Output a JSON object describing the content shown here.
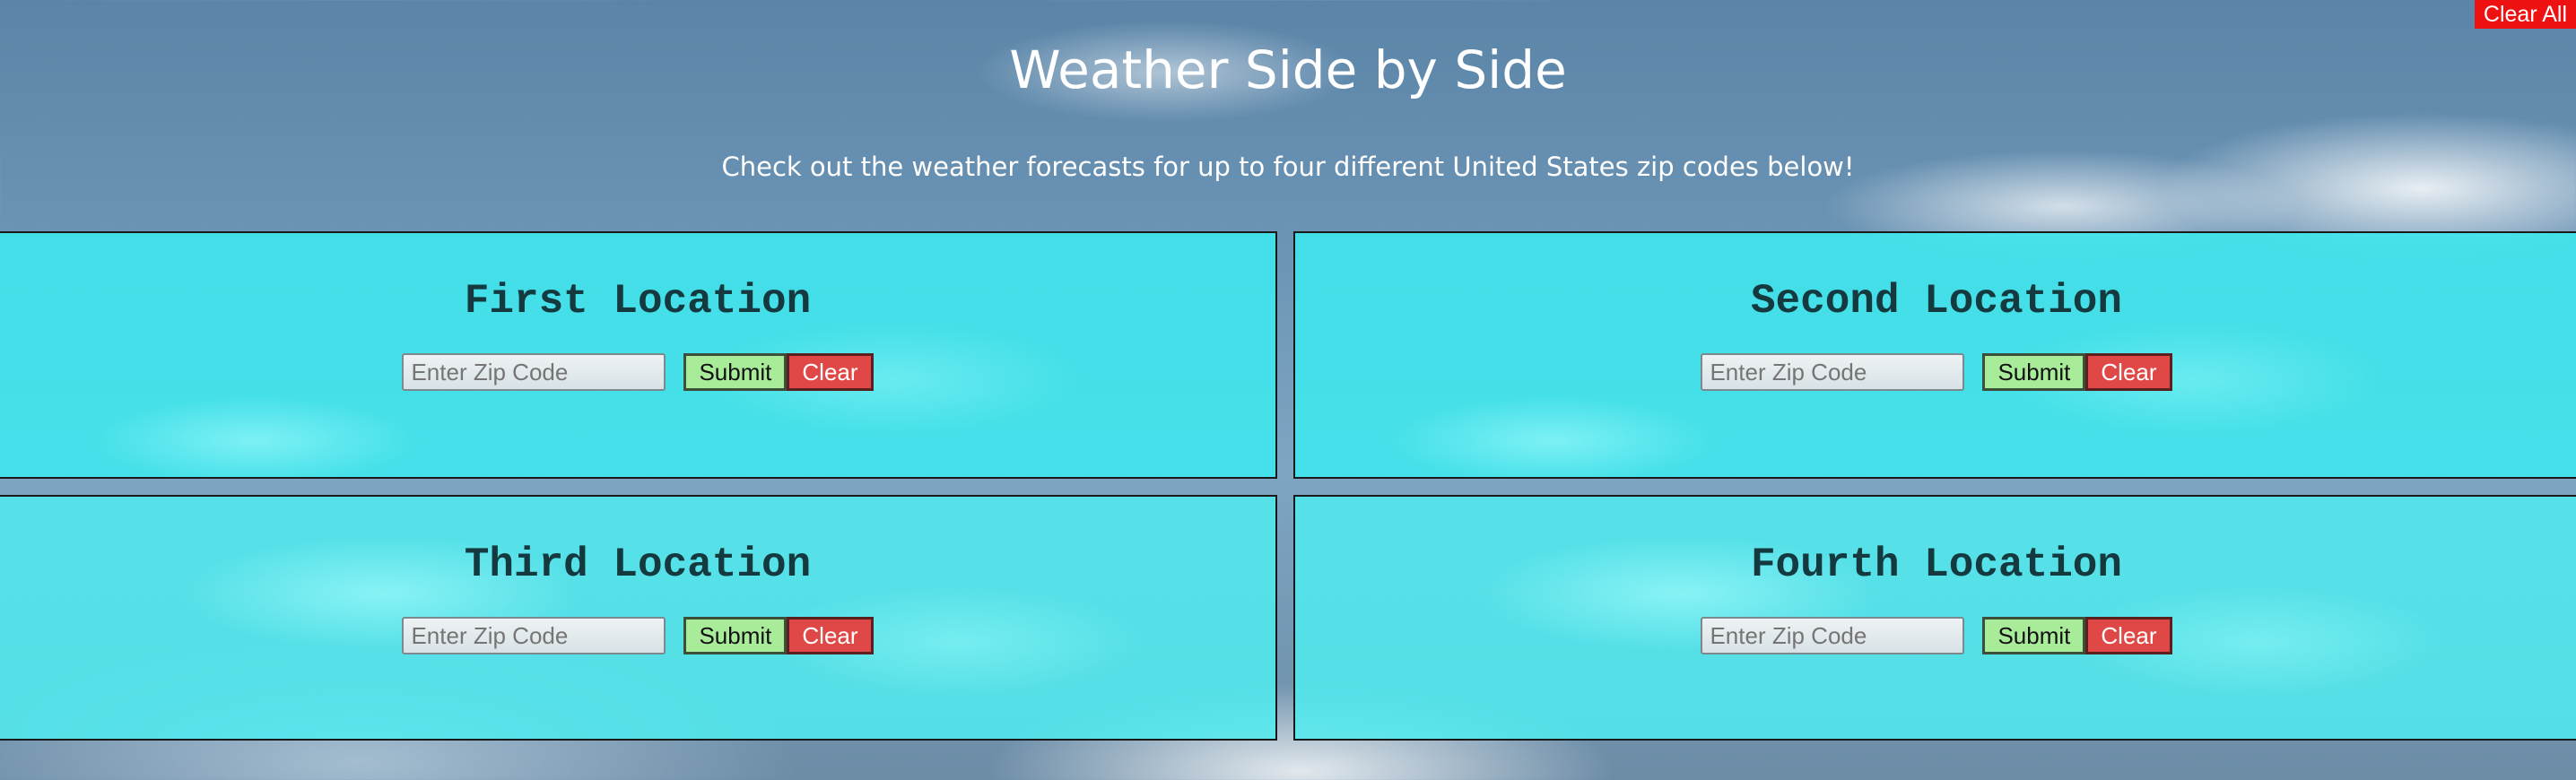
{
  "header": {
    "title": "Weather Side by Side",
    "subtitle": "Check out the weather forecasts for up to four different United States zip codes below!",
    "clear_all_label": "Clear All"
  },
  "colors": {
    "panel_bg": "#3ee8ee",
    "submit_bg": "#a8ec9a",
    "clear_bg": "#e04848",
    "clear_all_bg": "#ee1111"
  },
  "locations": [
    {
      "heading": "First Location",
      "zip_placeholder": "Enter Zip Code",
      "zip_value": "",
      "submit_label": "Submit",
      "clear_label": "Clear"
    },
    {
      "heading": "Second Location",
      "zip_placeholder": "Enter Zip Code",
      "zip_value": "",
      "submit_label": "Submit",
      "clear_label": "Clear"
    },
    {
      "heading": "Third Location",
      "zip_placeholder": "Enter Zip Code",
      "zip_value": "",
      "submit_label": "Submit",
      "clear_label": "Clear"
    },
    {
      "heading": "Fourth Location",
      "zip_placeholder": "Enter Zip Code",
      "zip_value": "",
      "submit_label": "Submit",
      "clear_label": "Clear"
    }
  ]
}
